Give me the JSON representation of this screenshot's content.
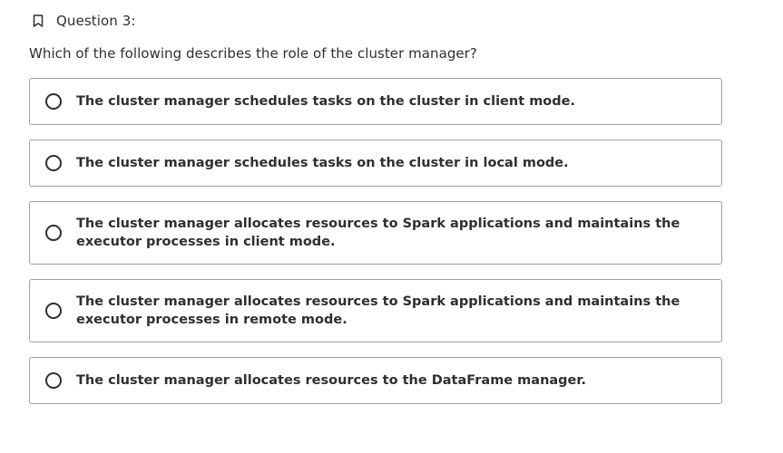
{
  "question": {
    "title": "Question 3:",
    "bookmark_icon": "bookmark-outline-icon",
    "prompt": "Which of the following describes the role of the cluster manager?"
  },
  "options": [
    {
      "label": "The cluster manager schedules tasks on the cluster in client mode.",
      "selected": false
    },
    {
      "label": "The cluster manager schedules tasks on the cluster in local mode.",
      "selected": false
    },
    {
      "label": "The cluster manager allocates resources to Spark applications and maintains the executor processes in client mode.",
      "selected": false
    },
    {
      "label": "The cluster manager allocates resources to Spark applications and maintains the executor processes in remote mode.",
      "selected": false
    },
    {
      "label": "The cluster manager allocates resources to the DataFrame manager.",
      "selected": false
    }
  ],
  "colors": {
    "text": "#2d2f31",
    "border": "#9aa0a5",
    "background": "#ffffff"
  }
}
